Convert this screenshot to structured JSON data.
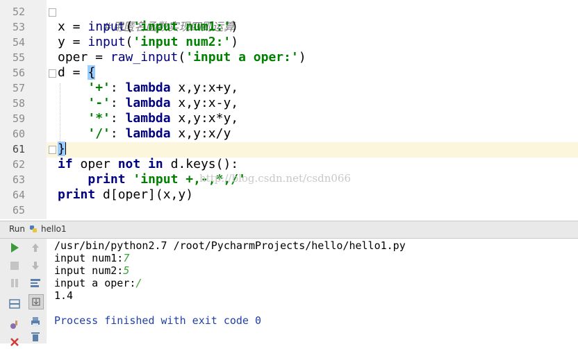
{
  "editor": {
    "line_numbers": [
      "52",
      "53",
      "54",
      "55",
      "56",
      "57",
      "58",
      "59",
      "60",
      "61",
      "62",
      "63",
      "64",
      "65"
    ],
    "current_line": "61",
    "comment_line": "#用匿名函数实现四则运算",
    "code": {
      "l53": {
        "lhs": "x = ",
        "func": "input",
        "open": "(",
        "str": "'input num1:'",
        "close": ")"
      },
      "l54": {
        "lhs": "y = ",
        "func": "input",
        "open": "(",
        "str": "'input num2:'",
        "close": ")"
      },
      "l55": {
        "lhs": "oper = ",
        "func": "raw_input",
        "open": "(",
        "str": "'input a oper:'",
        "close": ")"
      },
      "l56": {
        "lhs": "d = ",
        "brace": "{"
      },
      "l57": {
        "str": "'+'",
        "colon": ": ",
        "kw": "lambda",
        "rest": " x,y:x+y,"
      },
      "l58": {
        "str": "'-'",
        "colon": ": ",
        "kw": "lambda",
        "rest": " x,y:x-y,"
      },
      "l59": {
        "str": "'*'",
        "colon": ": ",
        "kw": "lambda",
        "rest": " x,y:x*y,"
      },
      "l60": {
        "str": "'/'",
        "colon": ": ",
        "kw": "lambda",
        "rest": " x,y:x/y"
      },
      "l61": {
        "brace": "}"
      },
      "l62": {
        "kw1": "if",
        "mid1": " oper ",
        "kw2": "not",
        "sp": " ",
        "kw3": "in",
        "rest": " d.keys():"
      },
      "l63": {
        "kw": "print",
        "sp": " ",
        "str": "'input +,-,*,/'"
      },
      "l64": {
        "kw": "print",
        "rest": " d[oper](x,y)"
      }
    },
    "watermark": "http://blog.csdn.net/csdn066"
  },
  "run_panel": {
    "label": "Run",
    "config_name": "hello1",
    "console": {
      "command": "/usr/bin/python2.7 /root/PycharmProjects/hello/hello1.py",
      "prompt1": "input num1:",
      "input1": "7",
      "prompt2": "input num2:",
      "input2": "5",
      "prompt3": "input a oper:",
      "input3": "/",
      "result": "1.4",
      "exit_message": "Process finished with exit code 0"
    }
  },
  "icons": [
    "rerun-icon",
    "stop-icon",
    "pause-icon",
    "layout-icon",
    "up-arrow-icon",
    "down-arrow-icon",
    "soft-wrap-icon",
    "scroll-to-end-icon",
    "settings-icon",
    "print-icon",
    "trash-icon",
    "close-icon",
    "python-icon"
  ],
  "colors": {
    "keyword": "#000080",
    "string": "#008000",
    "console_input": "#3aa33a",
    "exit_text": "#1f3faa",
    "caret_row": "#fbf6dc"
  }
}
